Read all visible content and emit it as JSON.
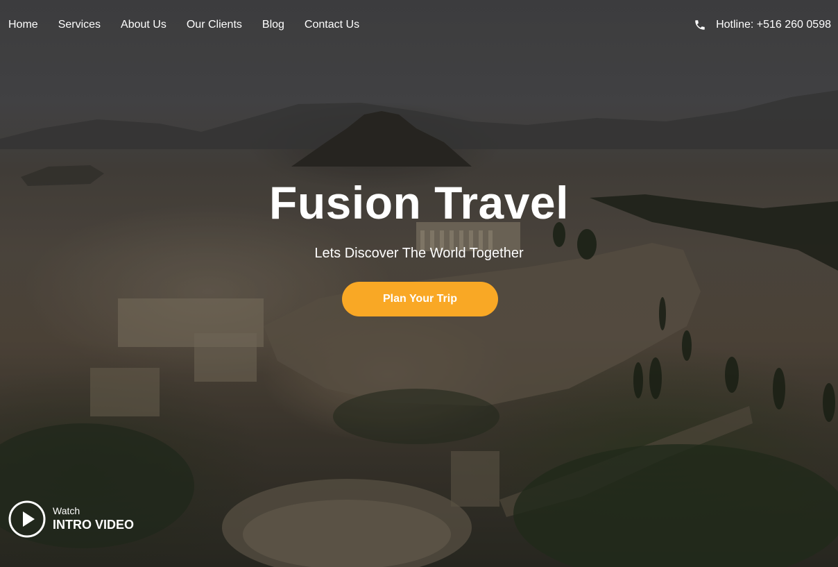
{
  "nav": {
    "items": [
      {
        "label": "Home"
      },
      {
        "label": "Services"
      },
      {
        "label": "About Us"
      },
      {
        "label": "Our Clients"
      },
      {
        "label": "Blog"
      },
      {
        "label": "Contact Us"
      }
    ]
  },
  "hotline": {
    "icon": "phone-icon",
    "label": "Hotline: +516 260 0598"
  },
  "hero": {
    "title": "Fusion Travel",
    "subtitle": "Lets Discover The World Together",
    "cta_label": "Plan Your Trip"
  },
  "video": {
    "icon": "play-circle-icon",
    "watch": "Watch",
    "label": "INTRO VIDEO"
  },
  "colors": {
    "accent": "#f9a825",
    "text": "#ffffff"
  }
}
